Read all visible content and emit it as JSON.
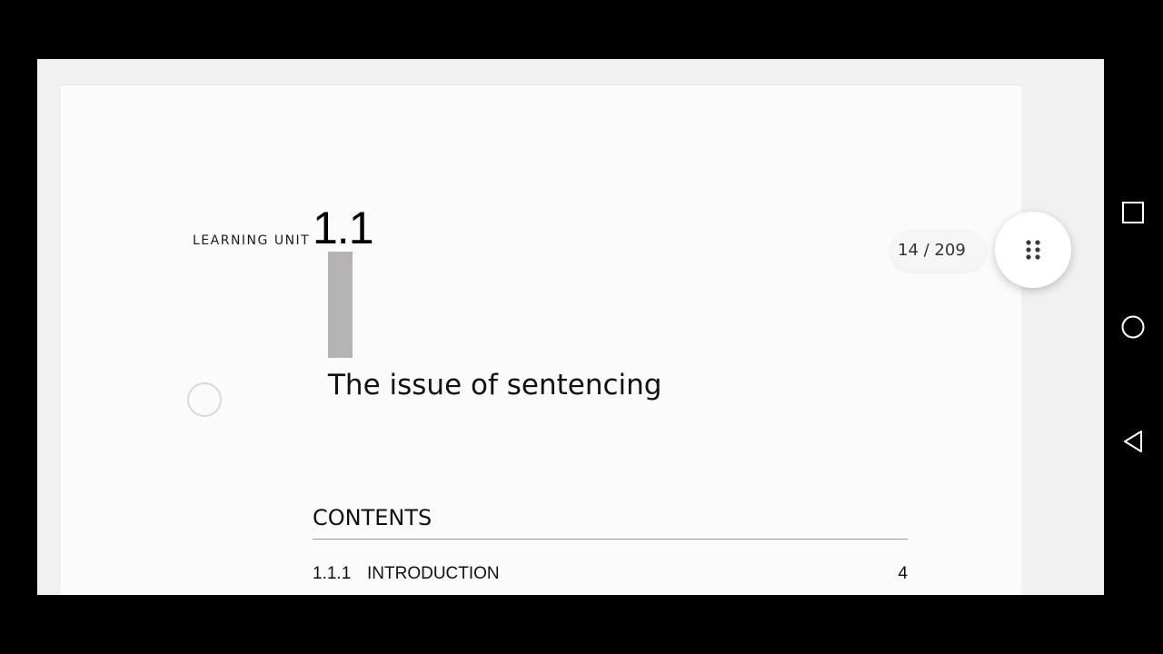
{
  "document": {
    "unit_label": "LEARNING UNIT",
    "unit_number": "1.1",
    "unit_title": "The issue of sentencing",
    "contents_heading": "CONTENTS",
    "toc": [
      {
        "number": "1.1.1",
        "title": "INTRODUCTION",
        "page": "4"
      }
    ]
  },
  "viewer": {
    "page_counter": "14 / 209",
    "grid_button_icon": "grid-dots-icon"
  },
  "nav_bar": {
    "icons": [
      "recent-apps-icon",
      "home-icon",
      "back-icon"
    ]
  },
  "colors": {
    "page_background": "#fcfbfc",
    "unit_bar": "#b5b3b4",
    "screen_frame": "#000000"
  }
}
